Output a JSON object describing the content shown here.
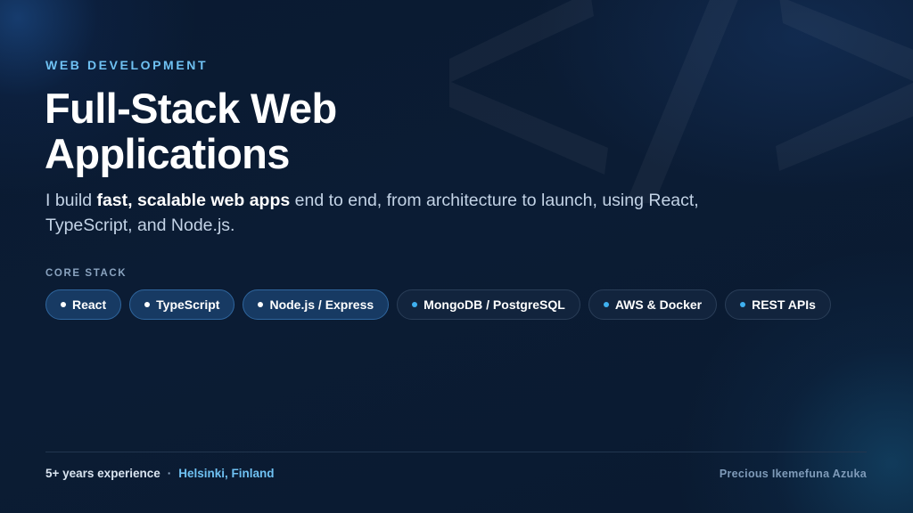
{
  "eyebrow": "WEB DEVELOPMENT",
  "title": {
    "line1": "Full-Stack Web",
    "line2": "Applications"
  },
  "subtitle": {
    "prefix": "I build ",
    "emphasis": "fast, scalable web apps",
    "suffix": " end to end, from architecture to launch, using React, TypeScript, and Node.js."
  },
  "core_stack": {
    "label": "CORE STACK",
    "items": [
      {
        "label": "React",
        "style": "primary"
      },
      {
        "label": "TypeScript",
        "style": "primary"
      },
      {
        "label": "Node.js / Express",
        "style": "primary"
      },
      {
        "label": "MongoDB / PostgreSQL",
        "style": "secondary"
      },
      {
        "label": "AWS & Docker",
        "style": "secondary"
      },
      {
        "label": "REST APIs",
        "style": "secondary"
      }
    ]
  },
  "footer": {
    "experience": "5+ years experience",
    "separator": "·",
    "location": "Helsinki, Finland",
    "author": "Precious Ikemefuna Azuka"
  },
  "colors": {
    "background": "#0b1a30",
    "accent": "#6fc1f2",
    "chip_dot_accent": "#3fb0f0"
  },
  "icons": {
    "background_glyph": "code-brackets-icon",
    "chip_bullet": "dot-icon"
  }
}
